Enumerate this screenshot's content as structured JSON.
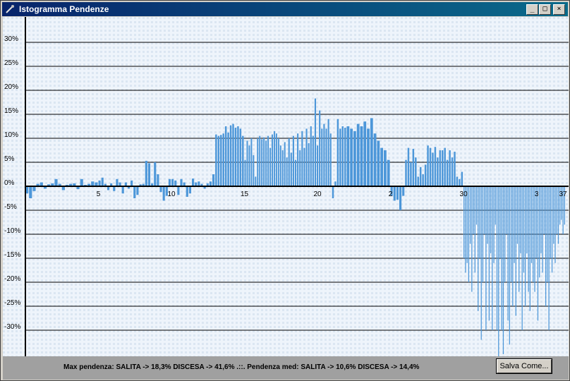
{
  "window": {
    "title": "Istogramma Pendenze",
    "controls": {
      "minimize": "_",
      "maximize": "□",
      "close": "×"
    }
  },
  "status": {
    "summary": "Max pendenza: SALITA -> 18,3% DISCESA -> 41,6% .::. Pendenza med: SALITA -> 10,6% DISCESA -> 14,4%",
    "save_label": "Salva Come..."
  },
  "chart_data": {
    "type": "bar",
    "title": "Istogramma Pendenze",
    "xlabel": "",
    "ylabel": "",
    "ylim": [
      -35,
      35
    ],
    "xlim": [
      0,
      37
    ],
    "y_ticks": [
      -30,
      -25,
      -20,
      -15,
      -10,
      -5,
      0,
      5,
      10,
      15,
      20,
      25,
      30
    ],
    "y_tick_labels": [
      "-30%",
      "-25%",
      "-20%",
      "-15%",
      "-10%",
      "-5%",
      "0%",
      "5%",
      "10%",
      "15%",
      "20%",
      "25%",
      "30%"
    ],
    "x_ticks": [
      5,
      10,
      15,
      20,
      25,
      30,
      35
    ],
    "x_tick_labels": [
      "5",
      "10",
      "15",
      "20",
      "2",
      "30",
      "3",
      "37"
    ],
    "x_tick_positions": [
      5,
      10,
      15,
      20,
      25,
      30,
      35,
      37
    ],
    "grid": true,
    "bar_color": "#4d97d9",
    "segments": [
      {
        "x0": 0.0,
        "x1": 5.0,
        "values": [
          -1.5,
          -2.5,
          -1,
          0.5,
          0.8,
          -0.5,
          0.4,
          0.6,
          1.5,
          0.5,
          -0.8,
          0.3,
          0.5,
          0.6,
          -0.6,
          1.5,
          0.3,
          0.5,
          1.0,
          0.8
        ]
      },
      {
        "x0": 5.0,
        "x1": 8.0,
        "values": [
          1.2,
          1.8,
          0.5,
          -0.8,
          0.6,
          -1.0,
          1.5,
          0.8,
          -1.5,
          0.8,
          -0.5,
          1.2,
          -2.5,
          -1.8,
          0.4
        ]
      },
      {
        "x0": 8.0,
        "x1": 10.0,
        "values": [
          0.5,
          5.3,
          4.8,
          0.6,
          5.0,
          2.5,
          -1.2,
          -3.0,
          -2.0,
          1.5
        ]
      },
      {
        "x0": 10.0,
        "x1": 13.0,
        "values": [
          1.5,
          1.2,
          -1.8,
          1.5,
          0.8,
          -2.2,
          -1.5,
          1.6,
          0.8,
          1.0,
          0.5,
          -0.5,
          0.6,
          1.0,
          2.5
        ]
      },
      {
        "x0": 13.0,
        "x1": 15.0,
        "values": [
          10.8,
          10.5,
          10.7,
          11.0,
          12.5,
          11.2,
          12.7,
          13.0,
          12.2,
          12.5,
          12.0,
          10.5
        ]
      },
      {
        "x0": 15.0,
        "x1": 18.0,
        "values": [
          5.5,
          9.5,
          8.5,
          10.0,
          6.5,
          2.0,
          10.0,
          10.5,
          9.8,
          10.2,
          9.5,
          10.5,
          8.0,
          10.8,
          11.5,
          11.0,
          10.0,
          8.5,
          7.5,
          9.2,
          6.0
        ]
      },
      {
        "x0": 18.0,
        "x1": 21.0,
        "values": [
          10.0,
          7.0,
          10.5,
          5.5,
          11.0,
          7.5,
          11.5,
          8.0,
          12.0,
          9.0,
          12.5,
          10.5,
          18.3,
          8.5,
          15.8,
          12.0,
          13.0,
          12.0,
          14.0,
          11.0
        ]
      },
      {
        "x0": 21.0,
        "x1": 22.0,
        "values": [
          -2.5,
          1.0,
          14.0,
          12.0,
          12.5,
          12.2
        ]
      },
      {
        "x0": 22.0,
        "x1": 25.0,
        "values": [
          12.5,
          12.0,
          11.5,
          13.0,
          12.5,
          13.5,
          12.0,
          14.2,
          11.0,
          9.5,
          8.0,
          7.5,
          5.5
        ]
      },
      {
        "x0": 25.0,
        "x1": 26.0,
        "values": [
          -2.0,
          -3.0,
          -2.8,
          -5.0,
          -2.0
        ]
      },
      {
        "x0": 26.0,
        "x1": 27.5,
        "values": [
          5.5,
          8.0,
          5.0,
          7.8,
          6.0,
          2.0,
          4.0,
          2.5,
          4.5
        ]
      },
      {
        "x0": 27.5,
        "x1": 29.5,
        "values": [
          8.5,
          8.0,
          7.0,
          8.2,
          6.0,
          7.5,
          7.5,
          8.0,
          5.5,
          7.5,
          6.0,
          7.2
        ]
      },
      {
        "x0": 29.5,
        "x1": 30.0,
        "values": [
          2.0,
          1.5,
          3.0
        ]
      },
      {
        "x0": 30.0,
        "x1": 37.0,
        "values": [
          -15,
          -18,
          -16,
          -20,
          -12,
          -22,
          -10,
          -18,
          -8,
          -26,
          -15,
          -32,
          -20,
          -10,
          -30,
          -12,
          -28,
          -14,
          -30,
          -16,
          -8,
          -30,
          -41.6,
          -15,
          -30,
          -35,
          -20,
          -10,
          -28,
          -33,
          -20,
          -25,
          -16,
          -27,
          -12,
          -22,
          -14,
          -30,
          -18,
          -25,
          -14,
          -22,
          -26,
          -16,
          -20,
          -22,
          -15,
          -28,
          -19,
          -14,
          -18,
          -10,
          -25,
          -20,
          -30,
          -15,
          -18,
          -12,
          -16,
          -10,
          -12,
          -8,
          -7,
          -10,
          -8
        ]
      }
    ]
  }
}
